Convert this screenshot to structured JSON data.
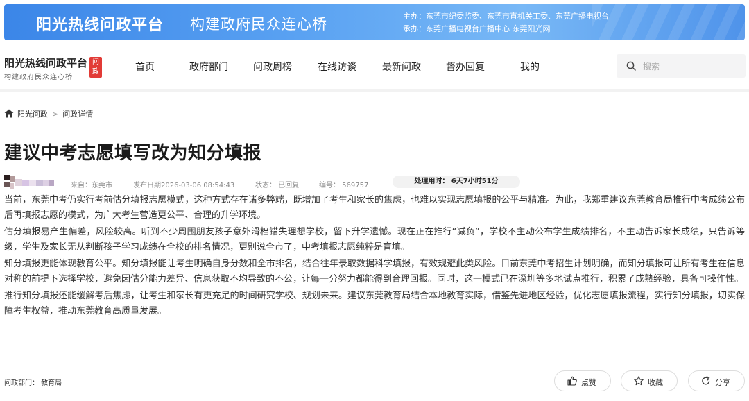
{
  "banner": {
    "title": "阳光热线问政平台",
    "slogan": "构建政府民众连心桥",
    "host": "主办：东莞市纪委监委、东莞市直机关工委、东莞广播电视台",
    "organizer": "承办：东莞广播电视台广播中心 东莞阳光网"
  },
  "logo": {
    "main": "阳光热线问政平台",
    "sub": "构建政府民众连心桥",
    "badge1": "问",
    "badge2": "政"
  },
  "nav": {
    "items": [
      "首页",
      "政府部门",
      "问政周榜",
      "在线访谈",
      "最新问政",
      "督办回复",
      "我的"
    ]
  },
  "search": {
    "placeholder": "搜索"
  },
  "breadcrumb": {
    "home": "阳光问政",
    "current": "问政详情"
  },
  "article": {
    "title": "建议中考志愿填写改为知分填报",
    "source": "来自：东莞市",
    "date": "发布日期2026-03-06 08:54:43",
    "status": "状态：  已回复",
    "number": "编号：  569757",
    "handle_time": "处理用时：  6天7小时51分",
    "paragraphs": [
      "当前，东莞中考仍实行考前估分填报志愿模式，这种方式存在诸多弊端，既增加了考生和家长的焦虑，也难以实现志愿填报的公平与精准。为此，我郑重建议东莞教育局推行中考成绩公布后再填报志愿的模式，为广大考生营造更公平、合理的升学环境。",
      "估分填报易产生偏差，风险较高。听到不少周围朋友孩子意外滑档错失理想学校，留下升学遗憾。现在正在推行“减负”，学校不主动公布学生成绩排名，不主动告诉家长成绩，只告诉等级，学生及家长无从判断孩子学习成绩在全校的排名情况，更别说全市了，中考填报志愿纯粹是盲填。",
      "知分填报更能体现教育公平。知分填报能让考生明确自身分数和全市排名，结合往年录取数据科学填报，有效规避此类风险。目前东莞中考招生计划明确，而知分填报可让所有考生在信息对称的前提下选择学校，避免因估分能力差异、信息获取不均导致的不公，让每一分努力都能得到合理回报。同时，这一模式已在深圳等多地试点推行，积累了成熟经验，具备可操作性。",
      "推行知分填报还能缓解考后焦虑，让考生和家长有更充足的时间研究学校、规划未来。建议东莞教育局结合本地教育实际，借鉴先进地区经验，优化志愿填报流程，实行知分填报，切实保障考生权益，推动东莞教育高质量发展。"
    ]
  },
  "footer": {
    "dept": "问政部门：  教育局",
    "like": "点赞",
    "collect": "收藏",
    "share": "分享"
  },
  "colors": {
    "banner": "#4f93ea",
    "badge": "#e23b36"
  }
}
